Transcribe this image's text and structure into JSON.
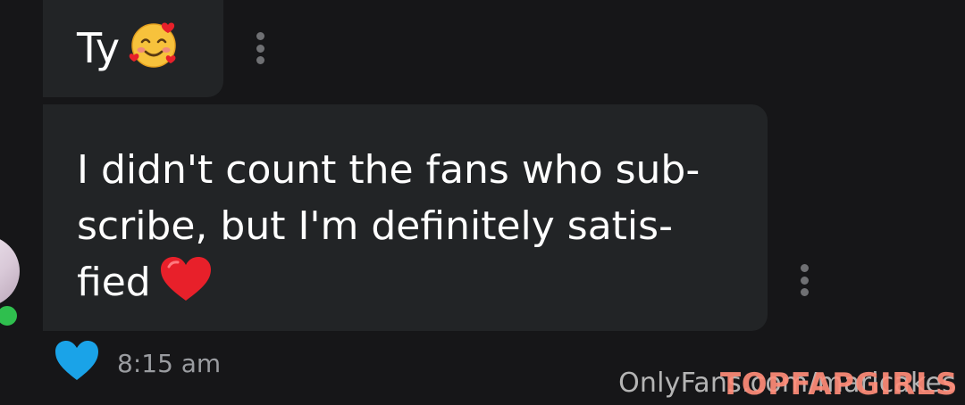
{
  "messages": [
    {
      "text": "Ty",
      "emoji": "smiling-face-with-hearts-icon"
    },
    {
      "text": "I didn't count the fans who sub-scribe, but I'm definitely satis-fied",
      "line1": "I didn't count the fans who sub-",
      "line2": "scribe, but I'm definitely satis-",
      "line3": "fied",
      "emoji": "red-heart-icon"
    }
  ],
  "footer": {
    "timestamp": "8:15 am",
    "like_icon": "blue-heart-icon"
  },
  "watermarks": {
    "site": "OnlyFans.com/maricakes",
    "brand": "TOPFAPGIRLS"
  },
  "colors": {
    "background": "#161618",
    "bubble": "#222426",
    "text": "#ffffff",
    "timestamp": "#9a9ca0",
    "like": "#1aa3e8",
    "online": "#2fbf4e",
    "heart": "#e8202a"
  }
}
